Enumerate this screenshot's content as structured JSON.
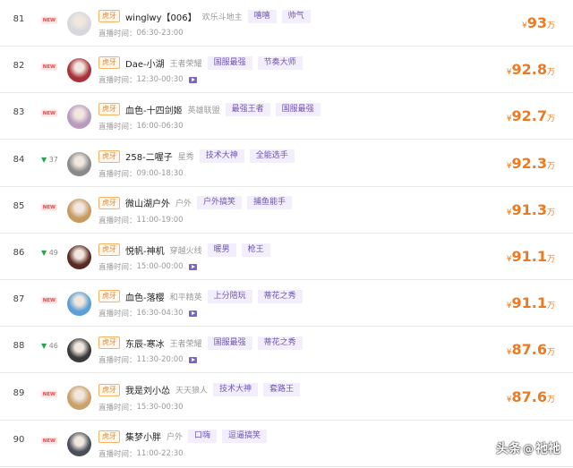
{
  "rows": [
    {
      "rank": "81",
      "trend": "new",
      "platform": "虎牙",
      "name": "winglwy【006】",
      "category": "欢乐斗地主",
      "tags": [
        "嘻嘻",
        "帅气"
      ],
      "time_label": "直播时间：",
      "time": "06:30-23:00",
      "vod": false,
      "currency": "¥",
      "amount": "93",
      "unit": "万",
      "avatar_color": "#d7d7dc"
    },
    {
      "rank": "82",
      "trend": "new",
      "platform": "虎牙",
      "name": "Dae-小湖",
      "category": "王者荣耀",
      "tags": [
        "国服最强",
        "节奏大师"
      ],
      "time_label": "直播时间：",
      "time": "12:30-00:30",
      "vod": true,
      "currency": "¥",
      "amount": "92.8",
      "unit": "万",
      "avatar_color": "#a8323a"
    },
    {
      "rank": "83",
      "trend": "new",
      "platform": "虎牙",
      "name": "血色-十四剑姬",
      "category": "英雄联盟",
      "tags": [
        "最强王者",
        "国服最强"
      ],
      "time_label": "直播时间：",
      "time": "16:00-06:30",
      "vod": false,
      "currency": "¥",
      "amount": "92.7",
      "unit": "万",
      "avatar_color": "#b89bbf"
    },
    {
      "rank": "84",
      "trend": "down",
      "trend_value": "37",
      "platform": "虎牙",
      "name": "258-二喔子",
      "category": "星秀",
      "tags": [
        "技术大神",
        "全能选手"
      ],
      "time_label": "直播时间：",
      "time": "09:00-18:30",
      "vod": false,
      "currency": "¥",
      "amount": "92.3",
      "unit": "万",
      "avatar_color": "#8a8a8a"
    },
    {
      "rank": "85",
      "trend": "new",
      "platform": "虎牙",
      "name": "微山湖户外",
      "category": "户外",
      "tags": [
        "户外搞笑",
        "捕鱼能手"
      ],
      "time_label": "直播时间：",
      "time": "11:00-19:00",
      "vod": false,
      "currency": "¥",
      "amount": "91.3",
      "unit": "万",
      "avatar_color": "#c79a62"
    },
    {
      "rank": "86",
      "trend": "down",
      "trend_value": "49",
      "platform": "虎牙",
      "name": "悦帆-神机",
      "category": "穿越火线",
      "tags": [
        "暖男",
        "枪王"
      ],
      "time_label": "直播时间：",
      "time": "15:00-00:00",
      "vod": true,
      "currency": "¥",
      "amount": "91.1",
      "unit": "万",
      "avatar_color": "#5a2a22"
    },
    {
      "rank": "87",
      "trend": "new",
      "platform": "虎牙",
      "name": "血色-落樱",
      "category": "和平精英",
      "tags": [
        "上分陪玩",
        "蒂花之秀"
      ],
      "time_label": "直播时间：",
      "time": "16:30-04:30",
      "vod": true,
      "currency": "¥",
      "amount": "91.1",
      "unit": "万",
      "avatar_color": "#5b9fd6"
    },
    {
      "rank": "88",
      "trend": "down",
      "trend_value": "46",
      "platform": "虎牙",
      "name": "东辰-寒冰",
      "category": "王者荣耀",
      "tags": [
        "国服最强",
        "蒂花之秀"
      ],
      "time_label": "直播时间：",
      "time": "11:30-20:00",
      "vod": true,
      "currency": "¥",
      "amount": "87.6",
      "unit": "万",
      "avatar_color": "#3a3a3a"
    },
    {
      "rank": "89",
      "trend": "new",
      "platform": "虎牙",
      "name": "我是刘小怂",
      "category": "天天狼人",
      "tags": [
        "技术大神",
        "套路王"
      ],
      "time_label": "直播时间：",
      "time": "15:30-00:30",
      "vod": false,
      "currency": "¥",
      "amount": "87.6",
      "unit": "万",
      "avatar_color": "#c9a16b"
    },
    {
      "rank": "90",
      "trend": "new",
      "platform": "虎牙",
      "name": "集梦小胖",
      "category": "户外",
      "tags": [
        "口嗨",
        "逗逼搞笑"
      ],
      "time_label": "直播时间：",
      "time": "11:00-22:30",
      "vod": false,
      "currency": "",
      "amount": "",
      "unit": "",
      "avatar_color": "#4a4f5a"
    }
  ],
  "trend_new_label": "NEW",
  "watermark": {
    "prefix": "头条",
    "at": "@",
    "account": "祂祂"
  }
}
